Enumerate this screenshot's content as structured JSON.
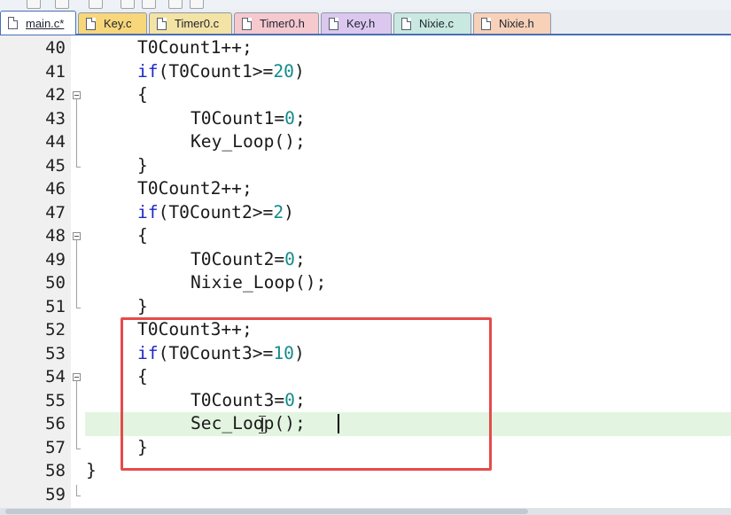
{
  "tabs": [
    {
      "label": "main.c*",
      "active": true,
      "color": "#ffffff"
    },
    {
      "label": "Key.c",
      "active": false,
      "color": "#f7d77a"
    },
    {
      "label": "Timer0.c",
      "active": false,
      "color": "#f3e3a5"
    },
    {
      "label": "Timer0.h",
      "active": false,
      "color": "#f6c9cf"
    },
    {
      "label": "Key.h",
      "active": false,
      "color": "#dcc8ef"
    },
    {
      "label": "Nixie.c",
      "active": false,
      "color": "#c9e8e0"
    },
    {
      "label": "Nixie.h",
      "active": false,
      "color": "#f7d1b8"
    }
  ],
  "code_lines": [
    {
      "n": "40",
      "indent": 1,
      "tokens": [
        {
          "t": "T0Count1++;",
          "c": "plain"
        }
      ]
    },
    {
      "n": "41",
      "indent": 1,
      "tokens": [
        {
          "t": "if",
          "c": "kw"
        },
        {
          "t": "(T0Count1>=",
          "c": "plain"
        },
        {
          "t": "20",
          "c": "num"
        },
        {
          "t": ")",
          "c": "plain"
        }
      ]
    },
    {
      "n": "42",
      "indent": 1,
      "tokens": [
        {
          "t": "{",
          "c": "plain"
        }
      ],
      "fold": "start"
    },
    {
      "n": "43",
      "indent": 2,
      "tokens": [
        {
          "t": "T0Count1=",
          "c": "plain"
        },
        {
          "t": "0",
          "c": "num"
        },
        {
          "t": ";",
          "c": "plain"
        }
      ]
    },
    {
      "n": "44",
      "indent": 2,
      "tokens": [
        {
          "t": "Key_Loop();",
          "c": "plain"
        }
      ]
    },
    {
      "n": "45",
      "indent": 1,
      "tokens": [
        {
          "t": "}",
          "c": "plain"
        }
      ],
      "fold": "end"
    },
    {
      "n": "46",
      "indent": 1,
      "tokens": [
        {
          "t": "T0Count2++;",
          "c": "plain"
        }
      ]
    },
    {
      "n": "47",
      "indent": 1,
      "tokens": [
        {
          "t": "if",
          "c": "kw"
        },
        {
          "t": "(T0Count2>=",
          "c": "plain"
        },
        {
          "t": "2",
          "c": "num"
        },
        {
          "t": ")",
          "c": "plain"
        }
      ]
    },
    {
      "n": "48",
      "indent": 1,
      "tokens": [
        {
          "t": "{",
          "c": "plain"
        }
      ],
      "fold": "start"
    },
    {
      "n": "49",
      "indent": 2,
      "tokens": [
        {
          "t": "T0Count2=",
          "c": "plain"
        },
        {
          "t": "0",
          "c": "num"
        },
        {
          "t": ";",
          "c": "plain"
        }
      ]
    },
    {
      "n": "50",
      "indent": 2,
      "tokens": [
        {
          "t": "Nixie_Loop();",
          "c": "plain"
        }
      ]
    },
    {
      "n": "51",
      "indent": 1,
      "tokens": [
        {
          "t": "}",
          "c": "plain"
        }
      ],
      "fold": "end"
    },
    {
      "n": "52",
      "indent": 1,
      "tokens": [
        {
          "t": "T0Count3++;",
          "c": "plain"
        }
      ]
    },
    {
      "n": "53",
      "indent": 1,
      "tokens": [
        {
          "t": "if",
          "c": "kw"
        },
        {
          "t": "(T0Count3>=",
          "c": "plain"
        },
        {
          "t": "10",
          "c": "num"
        },
        {
          "t": ")",
          "c": "plain"
        }
      ]
    },
    {
      "n": "54",
      "indent": 1,
      "tokens": [
        {
          "t": "{",
          "c": "plain"
        }
      ],
      "fold": "start"
    },
    {
      "n": "55",
      "indent": 2,
      "tokens": [
        {
          "t": "T0Count3=",
          "c": "plain"
        },
        {
          "t": "0",
          "c": "num"
        },
        {
          "t": ";",
          "c": "plain"
        }
      ]
    },
    {
      "n": "56",
      "indent": 2,
      "tokens": [
        {
          "t": "Sec_Loop();",
          "c": "plain"
        }
      ],
      "current": true
    },
    {
      "n": "57",
      "indent": 1,
      "tokens": [
        {
          "t": "}",
          "c": "plain"
        }
      ],
      "fold": "end"
    },
    {
      "n": "58",
      "indent": 0,
      "tokens": [
        {
          "t": "}",
          "c": "plain"
        }
      ]
    },
    {
      "n": "59",
      "indent": 0,
      "tokens": [],
      "fold": "end"
    }
  ],
  "colors": {
    "keyword": "#1e28c8",
    "number": "#138b8b",
    "current_line": "#e3f5e1",
    "annotation_box": "#e54b4b",
    "active_tab_border": "#4a6fb5"
  },
  "icons": [
    "file-icon",
    "fold-minus-icon",
    "text-cursor-icon"
  ]
}
